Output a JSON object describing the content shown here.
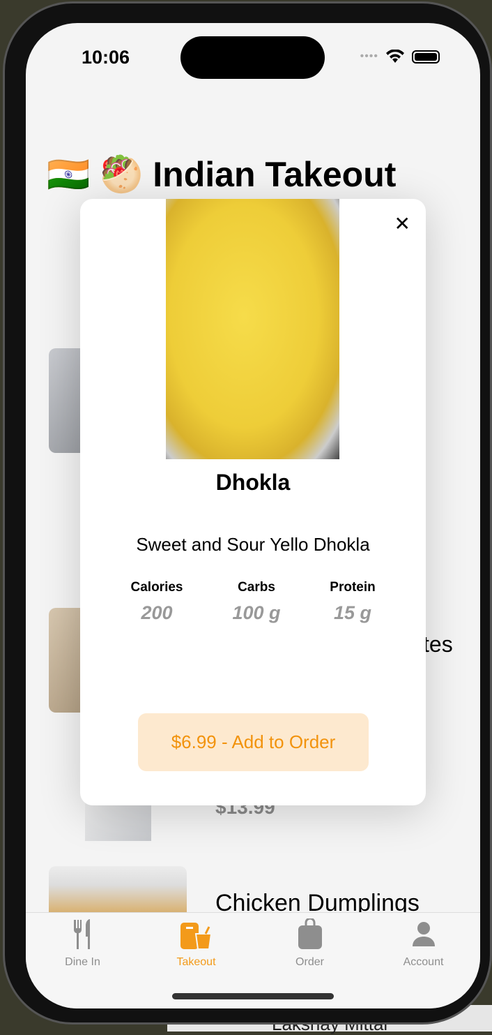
{
  "status": {
    "time": "10:06"
  },
  "header": {
    "title": "🇮🇳 🥙 Indian Takeout"
  },
  "list": {
    "partial_item_name": "tes",
    "item3_price": "$13.99",
    "item4_name": "Chicken Dumplings"
  },
  "modal": {
    "dish_name": "Dhokla",
    "description": "Sweet and Sour Yello Dhokla",
    "nutrition": [
      {
        "label": "Calories",
        "value": "200"
      },
      {
        "label": "Carbs",
        "value": "100 g"
      },
      {
        "label": "Protein",
        "value": "15 g"
      }
    ],
    "add_button": "$6.99 - Add to Order",
    "close": "✕"
  },
  "tabs": [
    {
      "label": "Dine In",
      "icon": "fork-knife-icon"
    },
    {
      "label": "Takeout",
      "icon": "takeout-bag-icon",
      "active": true
    },
    {
      "label": "Order",
      "icon": "bag-icon"
    },
    {
      "label": "Account",
      "icon": "person-icon"
    }
  ],
  "background": {
    "name": "Lakshay Mittal"
  },
  "colors": {
    "accent": "#f39a1a",
    "button_bg": "#fde9cf"
  }
}
